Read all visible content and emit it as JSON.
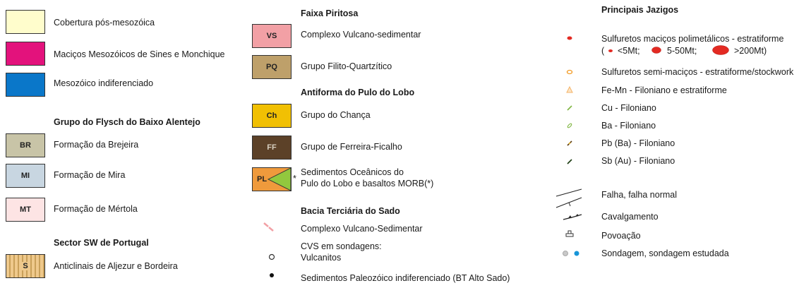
{
  "colors": {
    "cobertura": "#fffdcc",
    "macicos": "#e3127c",
    "mesozoico": "#0a77c9",
    "brejeira": "#c8c4a7",
    "mira": "#c8d6e1",
    "mertola": "#fde4e4",
    "aljezur": "#efc98c",
    "aljezur_stripe": "#c9a05a",
    "vs": "#f2a0a5",
    "pq": "#bea06a",
    "ch": "#f1c003",
    "ff": "#5c4128",
    "pl": "#ef9a3c",
    "pl_triangle": "#92c83e",
    "sulf_red": "#e32a22",
    "semi_orange": "#f39a23",
    "fe_mn": "#f4b46a",
    "cu_green": "#7fb541",
    "sondagem_blue": "#1895d8",
    "sondagem_grey": "#c8c8c8"
  },
  "col1": {
    "cobertura": "Cobertura pós-mesozóica",
    "macicos": "Maciços Mesozóicos de Sines e Monchique",
    "mesozoico": "Mesozóico indiferenciado",
    "flysch_title": "Grupo do Flysch do Baixo Alentejo",
    "br_code": "BR",
    "br_label": "Formação da Brejeira",
    "mi_code": "MI",
    "mi_label": "Formação de Mira",
    "mt_code": "MT",
    "mt_label": "Formação de Mértola",
    "sw_title": "Sector SW de Portugal",
    "s_code": "S",
    "s_label": "Anticlinais de Aljezur e Bordeira"
  },
  "col2": {
    "faixa_title": "Faixa Piritosa",
    "vs_code": "VS",
    "vs_label": "Complexo Vulcano-sedimentar",
    "pq_code": "PQ",
    "pq_label": "Grupo Filito-Quartzítico",
    "antiforma_title": "Antiforma do Pulo do Lobo",
    "ch_code": "Ch",
    "ch_label": "Grupo do Chança",
    "ff_code": "FF",
    "ff_label": "Grupo de Ferreira-Ficalho",
    "pl_code": "PL",
    "pl_asterisk": "*",
    "pl_label_1": "Sedimentos Oceânicos do",
    "pl_label_2": "Pulo do Lobo e basaltos MORB(*)",
    "sado_title": "Bacia Terciária do Sado",
    "cvs_label": "Complexo Vulcano-Sedimentar",
    "sondagens_label": "CVS em sondagens:",
    "vulcanitos_label": "Vulcanitos",
    "sedimentos_label": "Sedimentos Paleozóico indiferenciado (BT Alto Sado)"
  },
  "col3": {
    "title": "Principais Jazigos",
    "sulf_label": "Sulfuretos maciços polimetálicos - estratiforme",
    "size_open": "(",
    "size_1": "<5Mt;",
    "size_2": "5-50Mt;",
    "size_3": ">200Mt)",
    "semi_label": "Sulfuretos semi-maciços - estratiforme/stockwork",
    "femn_label": "Fe-Mn - Filoniano e estratiforme",
    "cu_label": "Cu - Filoniano",
    "ba_label": "Ba - Filoniano",
    "pb_label": "Pb (Ba) - Filoniano",
    "sb_label": "Sb (Au) - Filoniano",
    "falha_label": "Falha, falha normal",
    "cavalg_label": "Cavalgamento",
    "povoacao_label": "Povoação",
    "sondagem_label": "Sondagem, sondagem estudada"
  }
}
